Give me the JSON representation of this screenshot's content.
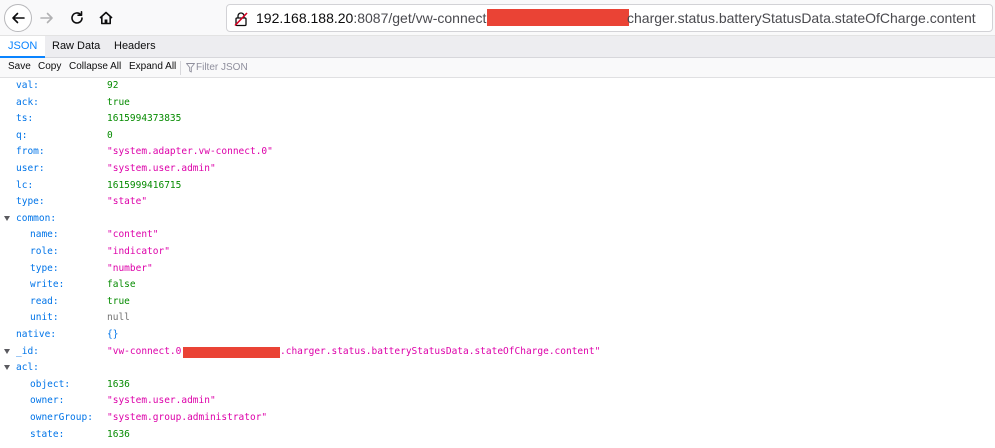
{
  "browser": {
    "url_host": "192.168.188.20",
    "url_path": ":8087/get/vw-connect.0.",
    "url_tail": "charger.status.batteryStatusData.stateOfCharge.content"
  },
  "viewer_tabs": [
    "JSON",
    "Raw Data",
    "Headers"
  ],
  "action_bar": {
    "save": "Save",
    "copy": "Copy",
    "collapse_all": "Collapse All",
    "expand_all": "Expand All",
    "filter_placeholder": "Filter JSON"
  },
  "rows": [
    {
      "key": "val:",
      "value": "92",
      "type": "num"
    },
    {
      "key": "ack:",
      "value": "true",
      "type": "bool"
    },
    {
      "key": "ts:",
      "value": "1615994373835",
      "type": "num"
    },
    {
      "key": "q:",
      "value": "0",
      "type": "num"
    },
    {
      "key": "from:",
      "value": "\"system.adapter.vw-connect.0\"",
      "type": "str"
    },
    {
      "key": "user:",
      "value": "\"system.user.admin\"",
      "type": "str"
    },
    {
      "key": "lc:",
      "value": "1615999416715",
      "type": "num"
    },
    {
      "key": "type:",
      "value": "\"state\"",
      "type": "str"
    },
    {
      "key": "common:",
      "value": "",
      "type": "section"
    },
    {
      "key": "name:",
      "value": "\"content\"",
      "type": "str"
    },
    {
      "key": "role:",
      "value": "\"indicator\"",
      "type": "str"
    },
    {
      "key": "type:",
      "value": "\"number\"",
      "type": "str"
    },
    {
      "key": "write:",
      "value": "false",
      "type": "bool"
    },
    {
      "key": "read:",
      "value": "true",
      "type": "bool"
    },
    {
      "key": "unit:",
      "value": "null",
      "type": "nul"
    },
    {
      "key": "native:",
      "value": "{}",
      "type": "obj"
    },
    {
      "key": "_id:",
      "value_start": "\"vw-connect.0.",
      "value_end": ".charger.status.batteryStatusData.stateOfCharge.content\"",
      "type": "str"
    },
    {
      "key": "acl:",
      "value": "",
      "type": "section"
    },
    {
      "key": "object:",
      "value": "1636",
      "type": "num"
    },
    {
      "key": "owner:",
      "value": "\"system.user.admin\"",
      "type": "str"
    },
    {
      "key": "ownerGroup:",
      "value": "\"system.group.administrator\"",
      "type": "str"
    },
    {
      "key": "state:",
      "value": "1636",
      "type": "num"
    }
  ],
  "colors": {
    "key": "#0074e8",
    "string": "#dd00a9",
    "number": "#058b00",
    "tab_selected": "#0a84ff",
    "redaction": "#ea4335"
  },
  "icons": [
    "back-arrow-icon",
    "forward-arrow-icon",
    "reload-icon",
    "home-icon",
    "insecure-lock-icon",
    "filter-icon",
    "expand-twisty-icon"
  ]
}
